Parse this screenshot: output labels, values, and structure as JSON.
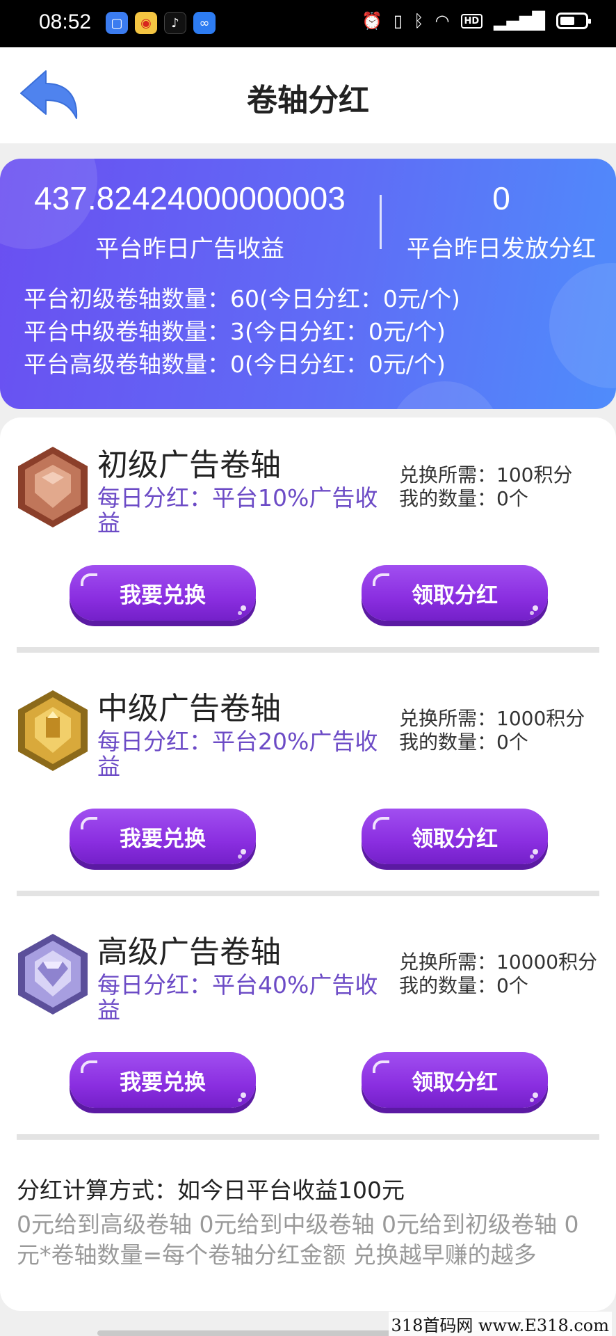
{
  "status_bar": {
    "time": "08:52",
    "apps": [
      "square-app-icon",
      "weibo-icon",
      "tiktok-icon",
      "infinity-app-icon"
    ],
    "sys_icons": [
      "alarm-icon",
      "vibrate-icon",
      "bluetooth-icon",
      "wifi-icon",
      "hd-icon",
      "signal-4g-icon",
      "battery-icon"
    ],
    "hd_label": "HD"
  },
  "header": {
    "title": "卷轴分红"
  },
  "stats": {
    "yesterday_ad_income_value": "437.82424000000003",
    "yesterday_ad_income_label": "平台昨日广告收益",
    "yesterday_dividend_value": "0",
    "yesterday_dividend_label": "平台昨日发放分红",
    "counts": [
      "平台初级卷轴数量：60(今日分红：0元/个)",
      "平台中级卷轴数量：3(今日分红：0元/个)",
      "平台高级卷轴数量：0(今日分红：0元/个)"
    ]
  },
  "tiers": [
    {
      "name": "初级广告卷轴",
      "desc": "每日分红：平台10%广告收益",
      "cost": "兑换所需：100积分",
      "owned": "我的数量：0个",
      "exchange_label": "我要兑换",
      "claim_label": "领取分红",
      "badge_color": "#b5654a"
    },
    {
      "name": "中级广告卷轴",
      "desc": "每日分红：平台20%广告收益",
      "cost": "兑换所需：1000积分",
      "owned": "我的数量：0个",
      "exchange_label": "我要兑换",
      "claim_label": "领取分红",
      "badge_color": "#d8a53a"
    },
    {
      "name": "高级广告卷轴",
      "desc": "每日分红：平台40%广告收益",
      "cost": "兑换所需：10000积分",
      "owned": "我的数量：0个",
      "exchange_label": "我要兑换",
      "claim_label": "领取分红",
      "badge_color": "#9a8fd6"
    }
  ],
  "rules": {
    "title": "分红计算方式：如今日平台收益100元",
    "text": "0元给到高级卷轴 0元给到中级卷轴 0元给到初级卷轴 0元*卷轴数量=每个卷轴分红金额 兑换越早赚的越多"
  },
  "watermark": "318首码网 www.E318.com",
  "colors": {
    "accent_purple": "#8a2ee0",
    "card_gradient_start": "#6a4ff1",
    "card_gradient_end": "#4f8cfb",
    "desc_text": "#6c4bc6"
  }
}
